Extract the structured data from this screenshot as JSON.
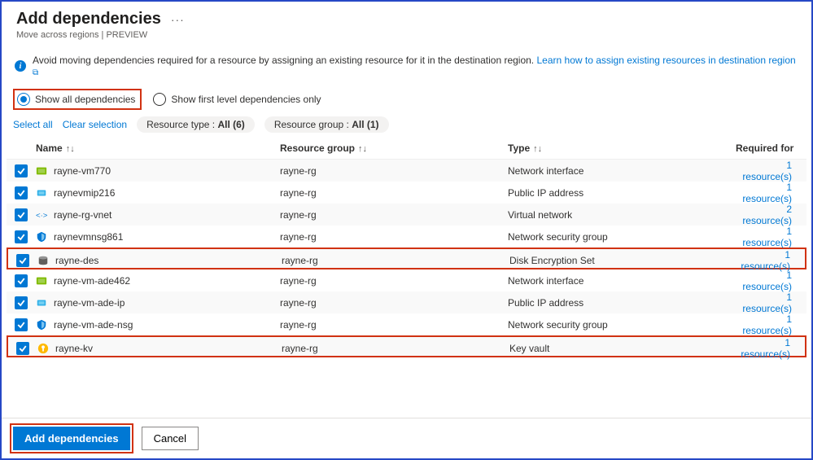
{
  "header": {
    "title": "Add dependencies",
    "more": "···",
    "subtitle": "Move across regions | PREVIEW"
  },
  "info": {
    "text": "Avoid moving dependencies required for a resource by assigning an existing resource for it in the destination region.",
    "link": "Learn how to assign existing resources in destination region"
  },
  "options": {
    "show_all": "Show all dependencies",
    "show_first": "Show first level dependencies only"
  },
  "filters": {
    "select_all": "Select all",
    "clear": "Clear selection",
    "type_label": "Resource type :",
    "type_value": "All (6)",
    "group_label": "Resource group :",
    "group_value": "All (1)"
  },
  "columns": {
    "name": "Name",
    "group": "Resource group",
    "type": "Type",
    "required": "Required for"
  },
  "rows": [
    {
      "icon": "nic",
      "icon_color1": "#7fba00",
      "icon_color2": "#a1d04e",
      "name": "rayne-vm770",
      "group": "rayne-rg",
      "type": "Network interface",
      "required": "1 resource(s)",
      "highlight": false
    },
    {
      "icon": "pip",
      "icon_color1": "#32b1e8",
      "icon_color2": "#76d0f2",
      "name": "raynevmip216",
      "group": "rayne-rg",
      "type": "Public IP address",
      "required": "1 resource(s)",
      "highlight": false
    },
    {
      "icon": "vnet",
      "icon_color1": "#0078d4",
      "icon_color2": "#50a9e0",
      "name": "rayne-rg-vnet",
      "group": "rayne-rg",
      "type": "Virtual network",
      "required": "2 resource(s)",
      "highlight": false
    },
    {
      "icon": "nsg",
      "icon_color1": "#0078d4",
      "icon_color2": "#7cc3f0",
      "name": "raynevmnsg861",
      "group": "rayne-rg",
      "type": "Network security group",
      "required": "1 resource(s)",
      "highlight": false
    },
    {
      "icon": "des",
      "icon_color1": "#605e5c",
      "icon_color2": "#939393",
      "name": "rayne-des",
      "group": "rayne-rg",
      "type": "Disk Encryption Set",
      "required": "1 resource(s)",
      "highlight": true
    },
    {
      "icon": "nic",
      "icon_color1": "#7fba00",
      "icon_color2": "#a1d04e",
      "name": "rayne-vm-ade462",
      "group": "rayne-rg",
      "type": "Network interface",
      "required": "1 resource(s)",
      "highlight": false
    },
    {
      "icon": "pip",
      "icon_color1": "#32b1e8",
      "icon_color2": "#76d0f2",
      "name": "rayne-vm-ade-ip",
      "group": "rayne-rg",
      "type": "Public IP address",
      "required": "1 resource(s)",
      "highlight": false
    },
    {
      "icon": "nsg",
      "icon_color1": "#0078d4",
      "icon_color2": "#7cc3f0",
      "name": "rayne-vm-ade-nsg",
      "group": "rayne-rg",
      "type": "Network security group",
      "required": "1 resource(s)",
      "highlight": false
    },
    {
      "icon": "kv",
      "icon_color1": "#ffb900",
      "icon_color2": "#ffd35e",
      "name": "rayne-kv",
      "group": "rayne-rg",
      "type": "Key vault",
      "required": "1 resource(s)",
      "highlight": true
    }
  ],
  "footer": {
    "add": "Add dependencies",
    "cancel": "Cancel"
  }
}
